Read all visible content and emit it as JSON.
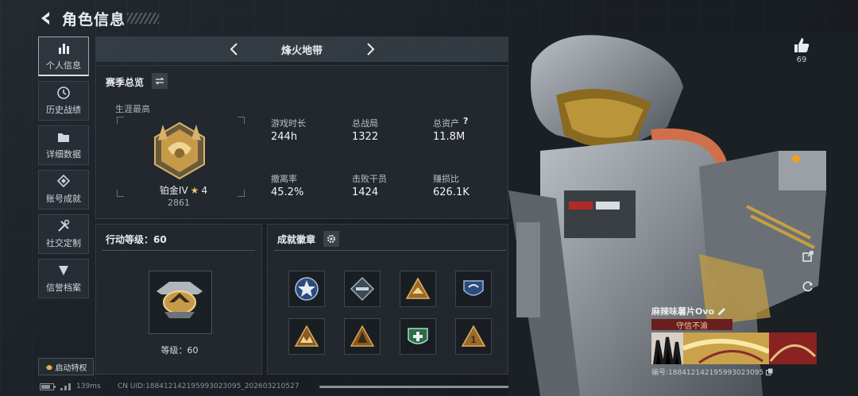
{
  "header": {
    "title": "角色信息"
  },
  "sidebar": {
    "items": [
      {
        "label": "个人信息",
        "icon": "bar-chart-icon"
      },
      {
        "label": "历史战绩",
        "icon": "history-icon"
      },
      {
        "label": "详细数据",
        "icon": "folder-icon"
      },
      {
        "label": "账号成就",
        "icon": "achievement-icon"
      },
      {
        "label": "社交定制",
        "icon": "tools-icon"
      },
      {
        "label": "信誉档案",
        "icon": "shield-icon"
      }
    ],
    "perk_label": "启动特权"
  },
  "map_selector": {
    "name": "烽火地带"
  },
  "season": {
    "title": "赛季总览",
    "career_label": "生涯最高",
    "rank_name": "铂金IV",
    "rank_stars": "4",
    "rank_score": "2861",
    "stats": [
      {
        "label": "游戏时长",
        "value": "244h"
      },
      {
        "label": "总战局",
        "value": "1322"
      },
      {
        "label": "总资产",
        "value": "11.8M"
      },
      {
        "label": "撤离率",
        "value": "45.2%"
      },
      {
        "label": "击败干员",
        "value": "1424"
      },
      {
        "label": "赚损比",
        "value": "626.1K"
      }
    ]
  },
  "action_level": {
    "title": "行动等级：60",
    "level_label": "等级：60"
  },
  "achievements": {
    "title": "成就徽章",
    "badge_count": 8
  },
  "status_bar": {
    "ping": "139ms",
    "uid": "CN UID:1884121421959930230​95_202603210527"
  },
  "player": {
    "likes": "69",
    "name": "麻辣味薯片Ovo",
    "reputation": "守信不渝",
    "id_label": "编号:18841214219599302309​5"
  },
  "colors": {
    "accent": "#d9e0e6",
    "reputation_bg": "#6a1f1f",
    "gold": "#c79a4a"
  }
}
